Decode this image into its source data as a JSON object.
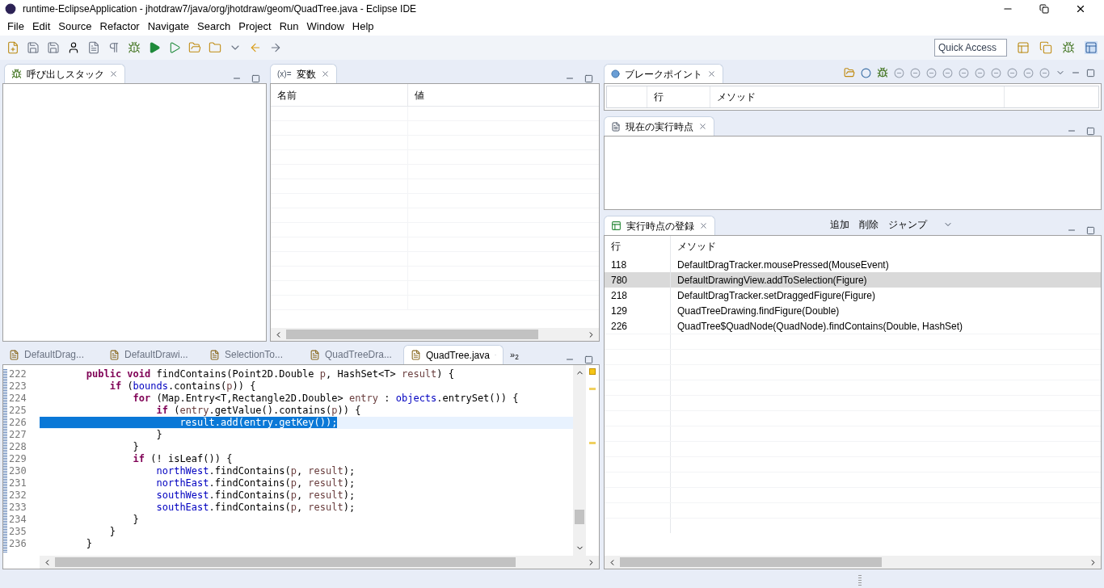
{
  "window": {
    "title": "runtime-EclipseApplication - jhotdraw7/java/org/jhotdraw/geom/QuadTree.java - Eclipse IDE"
  },
  "menu": [
    "File",
    "Edit",
    "Source",
    "Refactor",
    "Navigate",
    "Search",
    "Project",
    "Run",
    "Window",
    "Help"
  ],
  "quick_access": {
    "placeholder": "Quick Access"
  },
  "call_stack": {
    "title": "呼び出しスタック"
  },
  "variables": {
    "title": "変数",
    "title_prefix": "(x)=",
    "columns": [
      "名前",
      "値"
    ]
  },
  "breakpoints": {
    "title": "ブレークポイント",
    "columns": [
      "行",
      "メソッド"
    ]
  },
  "current_point": {
    "title": "現在の実行時点"
  },
  "registry": {
    "title": "実行時点の登録",
    "actions": [
      "追加",
      "削除",
      "ジャンプ"
    ],
    "columns": [
      "行",
      "メソッド"
    ],
    "rows": [
      {
        "line": "118",
        "method": "DefaultDragTracker.mousePressed(MouseEvent)",
        "selected": false
      },
      {
        "line": "780",
        "method": "DefaultDrawingView.addToSelection(Figure)",
        "selected": true
      },
      {
        "line": "218",
        "method": "DefaultDragTracker.setDraggedFigure(Figure)",
        "selected": false
      },
      {
        "line": "129",
        "method": "QuadTreeDrawing.findFigure(Double)",
        "selected": false
      },
      {
        "line": "226",
        "method": "QuadTree$QuadNode(QuadNode).findContains(Double, HashSet)",
        "selected": false
      }
    ]
  },
  "editor": {
    "tabs": [
      {
        "label": "DefaultDrag...",
        "selected": false
      },
      {
        "label": "DefaultDrawi...",
        "selected": false
      },
      {
        "label": "SelectionTo...",
        "selected": false
      },
      {
        "label": "QuadTreeDra...",
        "selected": false
      },
      {
        "label": "QuadTree.java",
        "selected": true
      }
    ],
    "overflow_marker": "»",
    "overflow_count": "2",
    "lines": [
      {
        "number": "222",
        "current": false,
        "tokens": [
          {
            "text": "        public void",
            "kind": "kw"
          },
          {
            "text": " findContains(Point2D.Double ",
            "kind": "plain"
          },
          {
            "text": "p",
            "kind": "param"
          },
          {
            "text": ", HashSet<T> ",
            "kind": "plain"
          },
          {
            "text": "result",
            "kind": "param"
          },
          {
            "text": ") {",
            "kind": "plain"
          }
        ]
      },
      {
        "number": "223",
        "current": false,
        "tokens": [
          {
            "text": "            if",
            "kind": "kw"
          },
          {
            "text": " (",
            "kind": "plain"
          },
          {
            "text": "bounds",
            "kind": "field"
          },
          {
            "text": ".contains(",
            "kind": "plain"
          },
          {
            "text": "p",
            "kind": "param"
          },
          {
            "text": ")) {",
            "kind": "plain"
          }
        ]
      },
      {
        "number": "224",
        "current": false,
        "tokens": [
          {
            "text": "                for",
            "kind": "kw"
          },
          {
            "text": " (Map.Entry<T,Rectangle2D.Double> ",
            "kind": "plain"
          },
          {
            "text": "entry",
            "kind": "param"
          },
          {
            "text": " : ",
            "kind": "plain"
          },
          {
            "text": "objects",
            "kind": "field"
          },
          {
            "text": ".entrySet()) {",
            "kind": "plain"
          }
        ]
      },
      {
        "number": "225",
        "current": false,
        "tokens": [
          {
            "text": "                    if",
            "kind": "kw"
          },
          {
            "text": " (",
            "kind": "plain"
          },
          {
            "text": "entry",
            "kind": "param"
          },
          {
            "text": ".getValue().contains(",
            "kind": "plain"
          },
          {
            "text": "p",
            "kind": "param"
          },
          {
            "text": ")) {",
            "kind": "plain"
          }
        ]
      },
      {
        "number": "226",
        "current": true,
        "tokens": [
          {
            "text": "                        result.add(entry.getKey());",
            "kind": "plain"
          }
        ]
      },
      {
        "number": "227",
        "current": false,
        "tokens": [
          {
            "text": "                    }",
            "kind": "plain"
          }
        ]
      },
      {
        "number": "228",
        "current": false,
        "tokens": [
          {
            "text": "                }",
            "kind": "plain"
          }
        ]
      },
      {
        "number": "229",
        "current": false,
        "tokens": [
          {
            "text": "                if",
            "kind": "kw"
          },
          {
            "text": " (! isLeaf()) {",
            "kind": "plain"
          }
        ]
      },
      {
        "number": "230",
        "current": false,
        "tokens": [
          {
            "text": "                    northWest",
            "kind": "field"
          },
          {
            "text": ".findContains(",
            "kind": "plain"
          },
          {
            "text": "p",
            "kind": "param"
          },
          {
            "text": ", ",
            "kind": "plain"
          },
          {
            "text": "result",
            "kind": "param"
          },
          {
            "text": ");",
            "kind": "plain"
          }
        ]
      },
      {
        "number": "231",
        "current": false,
        "tokens": [
          {
            "text": "                    northEast",
            "kind": "field"
          },
          {
            "text": ".findContains(",
            "kind": "plain"
          },
          {
            "text": "p",
            "kind": "param"
          },
          {
            "text": ", ",
            "kind": "plain"
          },
          {
            "text": "result",
            "kind": "param"
          },
          {
            "text": ");",
            "kind": "plain"
          }
        ]
      },
      {
        "number": "232",
        "current": false,
        "tokens": [
          {
            "text": "                    southWest",
            "kind": "field"
          },
          {
            "text": ".findContains(",
            "kind": "plain"
          },
          {
            "text": "p",
            "kind": "param"
          },
          {
            "text": ", ",
            "kind": "plain"
          },
          {
            "text": "result",
            "kind": "param"
          },
          {
            "text": ");",
            "kind": "plain"
          }
        ]
      },
      {
        "number": "233",
        "current": false,
        "tokens": [
          {
            "text": "                    southEast",
            "kind": "field"
          },
          {
            "text": ".findContains(",
            "kind": "plain"
          },
          {
            "text": "p",
            "kind": "param"
          },
          {
            "text": ", ",
            "kind": "plain"
          },
          {
            "text": "result",
            "kind": "param"
          },
          {
            "text": ");",
            "kind": "plain"
          }
        ]
      },
      {
        "number": "234",
        "current": false,
        "tokens": [
          {
            "text": "                }",
            "kind": "plain"
          }
        ]
      },
      {
        "number": "235",
        "current": false,
        "tokens": [
          {
            "text": "            }",
            "kind": "plain"
          }
        ]
      },
      {
        "number": "236",
        "current": false,
        "tokens": [
          {
            "text": "        }",
            "kind": "plain"
          }
        ]
      }
    ]
  }
}
